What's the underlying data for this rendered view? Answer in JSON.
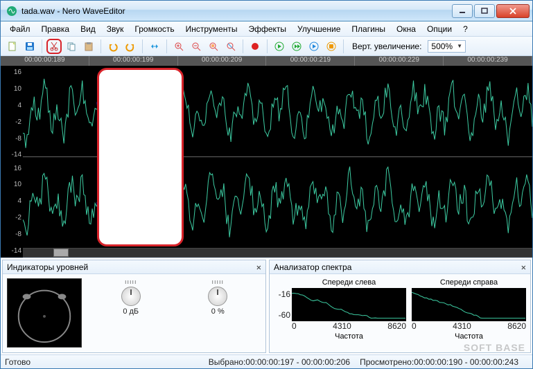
{
  "window": {
    "title": "tada.wav - Nero WaveEditor"
  },
  "menu": {
    "items": [
      "Файл",
      "Правка",
      "Вид",
      "Звук",
      "Громкость",
      "Инструменты",
      "Эффекты",
      "Улучшение",
      "Плагины",
      "Окна",
      "Опции",
      "?"
    ]
  },
  "toolbar": {
    "zoom_label": "Верт. увеличение:",
    "zoom_value": "500%",
    "icons": [
      "new",
      "save",
      "cut",
      "copy",
      "paste",
      "undo",
      "redo",
      "sel-all",
      "zoom-in",
      "zoom-out",
      "zoom-sel",
      "zoom-fit",
      "record",
      "play",
      "play-loop",
      "play-sel",
      "stop"
    ]
  },
  "ruler": {
    "times": [
      "00:00:00:189",
      "00:00:00:199",
      "00:00:00:209",
      "00:00:00:219",
      "00:00:00:229",
      "00:00:00:239"
    ]
  },
  "yaxis": {
    "top": [
      "16",
      "10",
      "4",
      "-2",
      "-8",
      "-14"
    ],
    "bottom": [
      "16",
      "10",
      "4",
      "-2",
      "-8",
      "-14"
    ]
  },
  "selection": {
    "left_pct": 14.5,
    "width_pct": 17
  },
  "panels": {
    "levels": {
      "title": "Индикаторы уровней",
      "knob1": "0 дБ",
      "knob2": "0 %"
    },
    "spectrum": {
      "title": "Анализатор спектра",
      "left": "Спереди слева",
      "right": "Спереди справа",
      "y": [
        "-16",
        "-60"
      ],
      "x": [
        "0",
        "4310",
        "8620"
      ],
      "freq": "Частота"
    }
  },
  "status": {
    "ready": "Готово",
    "selected": "Выбрано:00:00:00:197 - 00:00:00:206",
    "viewed": "Просмотрено:00:00:00:190 - 00:00:00:243"
  },
  "watermark": "SOFT BASE"
}
